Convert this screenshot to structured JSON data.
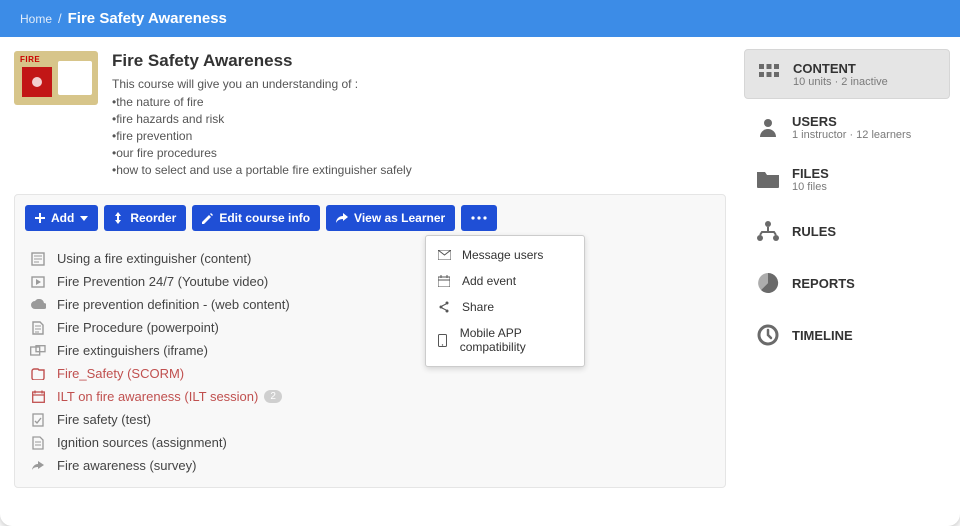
{
  "breadcrumb": {
    "home": "Home",
    "title": "Fire Safety Awareness"
  },
  "course": {
    "title": "Fire Safety Awareness",
    "lead": "This course will give you an understanding of :",
    "bullets": [
      "•the nature of fire",
      "•fire hazards and risk",
      "•fire prevention",
      "•our fire procedures",
      "•how to select and use a portable fire extinguisher safely"
    ]
  },
  "toolbar": {
    "add": "Add",
    "reorder": "Reorder",
    "edit": "Edit course info",
    "view": "View as Learner"
  },
  "more_menu": {
    "message": "Message users",
    "event": "Add event",
    "share": "Share",
    "mobile": "Mobile APP compatibility"
  },
  "units": [
    {
      "label": "Using a fire extinguisher (content)",
      "icon": "content"
    },
    {
      "label": "Fire Prevention 24/7 (Youtube video)",
      "icon": "video"
    },
    {
      "label": "Fire prevention definition - (web content)",
      "icon": "cloud"
    },
    {
      "label": "Fire Procedure (powerpoint)",
      "icon": "ppt"
    },
    {
      "label": "Fire extinguishers (iframe)",
      "icon": "iframe"
    },
    {
      "label": "Fire_Safety (SCORM)",
      "icon": "scorm",
      "highlight": true
    },
    {
      "label": "ILT on fire awareness (ILT session)",
      "icon": "ilt",
      "highlight": true,
      "badge": "2"
    },
    {
      "label": "Fire safety (test)",
      "icon": "test"
    },
    {
      "label": "Ignition sources (assignment)",
      "icon": "assign"
    },
    {
      "label": "Fire awareness (survey)",
      "icon": "survey"
    }
  ],
  "side": {
    "content": {
      "title": "CONTENT",
      "sub": "10 units · 2 inactive"
    },
    "users": {
      "title": "USERS",
      "sub": "1 instructor · 12 learners"
    },
    "files": {
      "title": "FILES",
      "sub": "10 files"
    },
    "rules": {
      "title": "RULES"
    },
    "reports": {
      "title": "REPORTS"
    },
    "timeline": {
      "title": "TIMELINE"
    }
  },
  "thumb_label": "FIRE"
}
